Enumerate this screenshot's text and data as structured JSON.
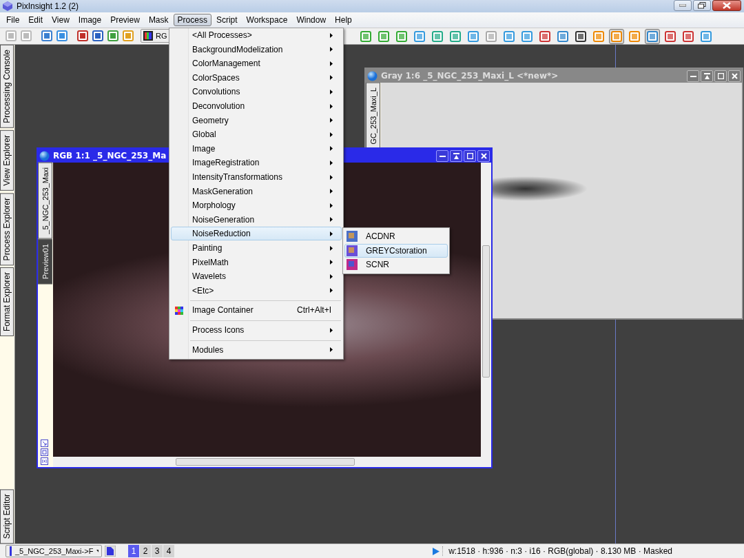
{
  "window": {
    "title": "PixInsight 1.2 (2)"
  },
  "menu_bar": [
    {
      "label": "File",
      "selected": false
    },
    {
      "label": "Edit",
      "selected": false
    },
    {
      "label": "View",
      "selected": false
    },
    {
      "label": "Image",
      "selected": false
    },
    {
      "label": "Preview",
      "selected": false
    },
    {
      "label": "Mask",
      "selected": false
    },
    {
      "label": "Process",
      "selected": true
    },
    {
      "label": "Script",
      "selected": false
    },
    {
      "label": "Workspace",
      "selected": false
    },
    {
      "label": "Window",
      "selected": false
    },
    {
      "label": "Help",
      "selected": false
    }
  ],
  "toolbar": {
    "view_selector": "RG"
  },
  "dock_tabs": [
    "Processing Console",
    "View Explorer",
    "Process Explorer",
    "Format Explorer"
  ],
  "dock_bottom_tabs": [
    "Script Editor"
  ],
  "image_windows": [
    {
      "kind": "gray",
      "title": "Gray 1:6 _5_NGC_253_Maxi_L <*new*>",
      "active": false,
      "tabs": [
        {
          "label": "GC_253_Maxi_L",
          "selected": true
        }
      ]
    },
    {
      "kind": "rgb",
      "title": "RGB 1:1 _5_NGC_253_Ma",
      "active": true,
      "tabs": [
        {
          "label": "_5_NGC_253_Maxi",
          "selected": true
        },
        {
          "label": "Preview01",
          "selected": false
        }
      ]
    }
  ],
  "process_menu": [
    {
      "kind": "submenu",
      "label": "<All Processes>",
      "selected": false
    },
    {
      "kind": "submenu",
      "label": "BackgroundModelization",
      "selected": false
    },
    {
      "kind": "submenu",
      "label": "ColorManagement",
      "selected": false
    },
    {
      "kind": "submenu",
      "label": "ColorSpaces",
      "selected": false
    },
    {
      "kind": "submenu",
      "label": "Convolutions",
      "selected": false
    },
    {
      "kind": "submenu",
      "label": "Deconvolution",
      "selected": false
    },
    {
      "kind": "submenu",
      "label": "Geometry",
      "selected": false
    },
    {
      "kind": "submenu",
      "label": "Global",
      "selected": false
    },
    {
      "kind": "submenu",
      "label": "Image",
      "selected": false
    },
    {
      "kind": "submenu",
      "label": "ImageRegistration",
      "selected": false
    },
    {
      "kind": "submenu",
      "label": "IntensityTransformations",
      "selected": false
    },
    {
      "kind": "submenu",
      "label": "MaskGeneration",
      "selected": false
    },
    {
      "kind": "submenu",
      "label": "Morphology",
      "selected": false
    },
    {
      "kind": "submenu",
      "label": "NoiseGeneration",
      "selected": false
    },
    {
      "kind": "submenu",
      "label": "NoiseReduction",
      "selected": true
    },
    {
      "kind": "submenu",
      "label": "Painting",
      "selected": false
    },
    {
      "kind": "submenu",
      "label": "PixelMath",
      "selected": false
    },
    {
      "kind": "submenu",
      "label": "Wavelets",
      "selected": false
    },
    {
      "kind": "submenu",
      "label": "<Etc>",
      "selected": false
    },
    {
      "kind": "separator"
    },
    {
      "kind": "item",
      "label": "Image Container",
      "shortcut": "Ctrl+Alt+I",
      "selected": false
    },
    {
      "kind": "separator"
    },
    {
      "kind": "submenu",
      "label": "Process Icons",
      "selected": false
    },
    {
      "kind": "separator"
    },
    {
      "kind": "submenu",
      "label": "Modules",
      "selected": false
    }
  ],
  "noise_reduction_submenu": [
    {
      "label": "ACDNR",
      "selected": false
    },
    {
      "label": "GREYCstoration",
      "selected": true
    },
    {
      "label": "SCNR",
      "selected": false
    }
  ],
  "status_bar": {
    "view_selector": "_5_NGC_253_Maxi->F",
    "workspaces": [
      {
        "label": "1",
        "selected": true
      },
      {
        "label": "2",
        "selected": false
      },
      {
        "label": "3",
        "selected": false
      },
      {
        "label": "4",
        "selected": false
      }
    ],
    "info": "w:1518 · h:936 · n:3 · i16 · RGB(global) · 8.130 MB · Masked"
  }
}
